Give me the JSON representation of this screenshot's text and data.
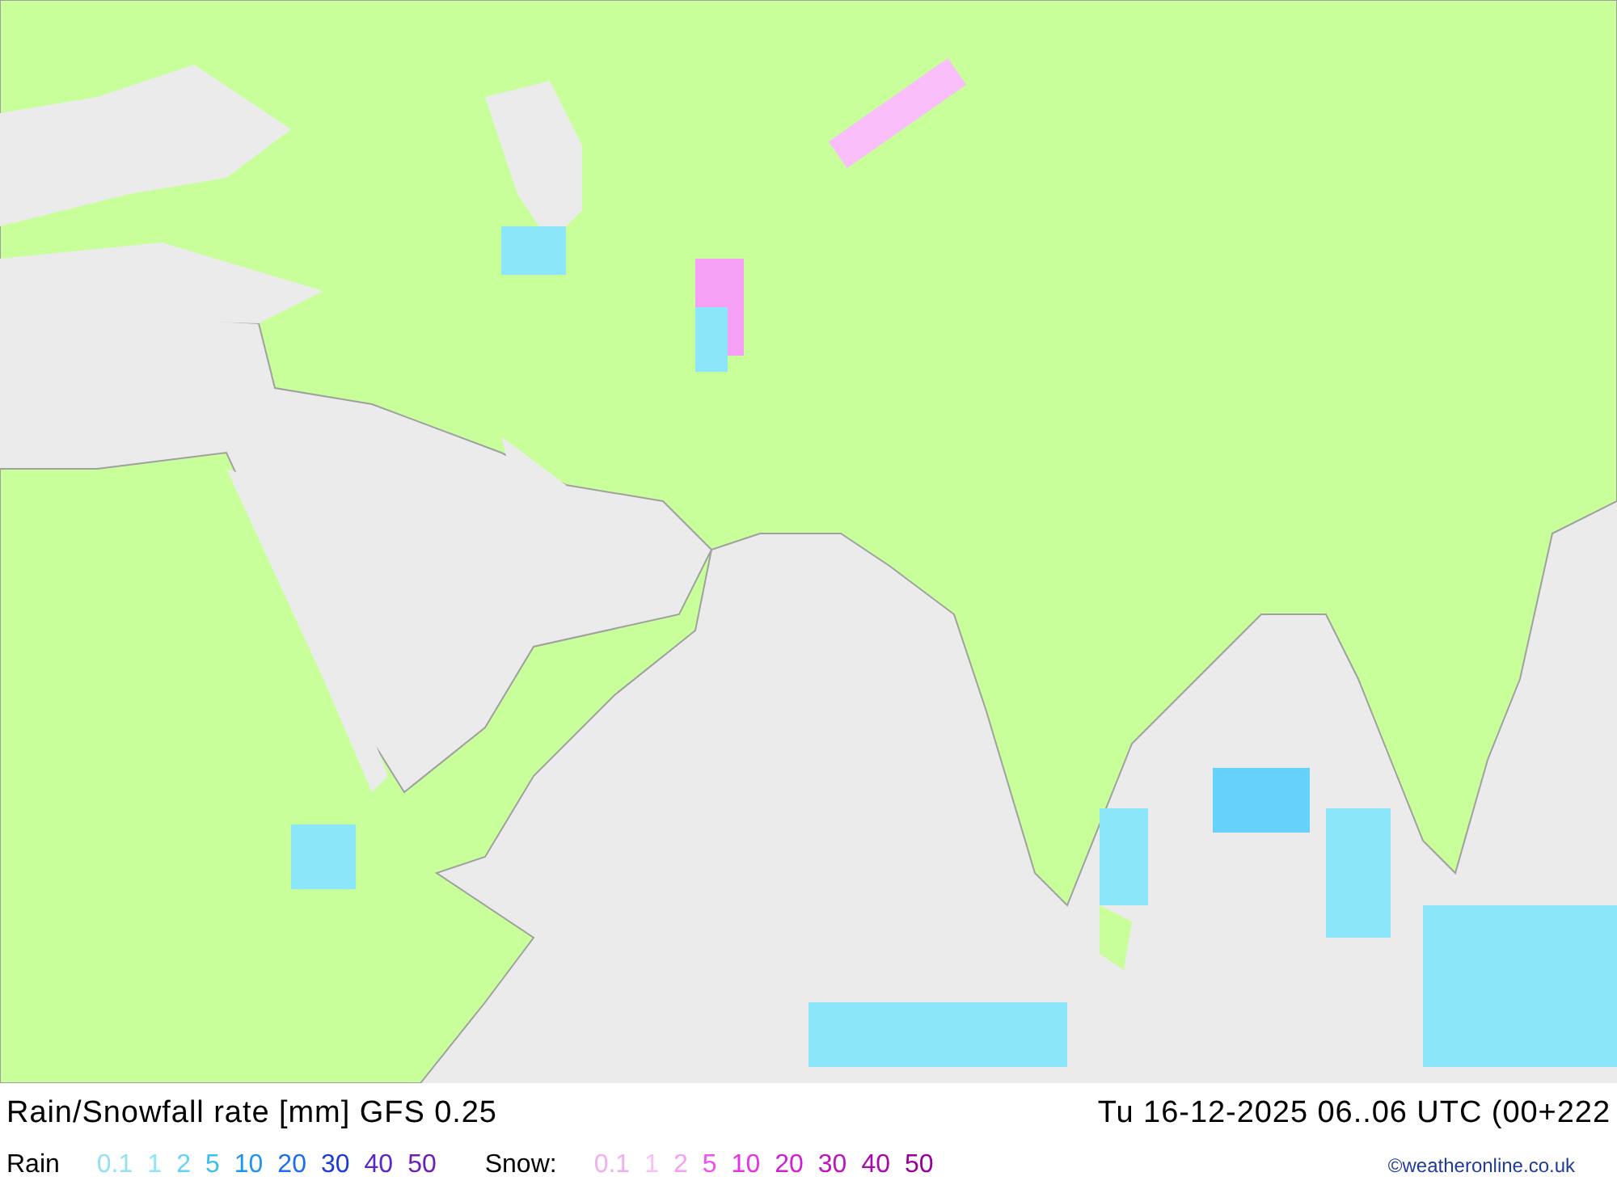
{
  "title": "Rain/Snowfall rate [mm] GFS 0.25",
  "valid_time": "Tu 16-12-2025 06..06 UTC (00+222",
  "legend": {
    "rain_label": "Rain",
    "rain": [
      {
        "label": "0.1",
        "color": "#96e0f0"
      },
      {
        "label": "1",
        "color": "#8ce6fa"
      },
      {
        "label": "2",
        "color": "#64d2fa"
      },
      {
        "label": "5",
        "color": "#3cbef0"
      },
      {
        "label": "10",
        "color": "#1e96f0"
      },
      {
        "label": "20",
        "color": "#1e6ef0"
      },
      {
        "label": "30",
        "color": "#1e3cd2"
      },
      {
        "label": "40",
        "color": "#5a28c8"
      },
      {
        "label": "50",
        "color": "#6e1eb4"
      }
    ],
    "snow_label": "Snow:",
    "snow": [
      {
        "label": "0.1",
        "color": "#f0b0f0"
      },
      {
        "label": "1",
        "color": "#fabefa"
      },
      {
        "label": "2",
        "color": "#f5a0f5"
      },
      {
        "label": "5",
        "color": "#f050f0"
      },
      {
        "label": "10",
        "color": "#e632e6"
      },
      {
        "label": "20",
        "color": "#d21ed2"
      },
      {
        "label": "30",
        "color": "#be14be"
      },
      {
        "label": "40",
        "color": "#aa0aaa"
      },
      {
        "label": "50",
        "color": "#960096"
      }
    ]
  },
  "credit": "©weatheronline.co.uk"
}
